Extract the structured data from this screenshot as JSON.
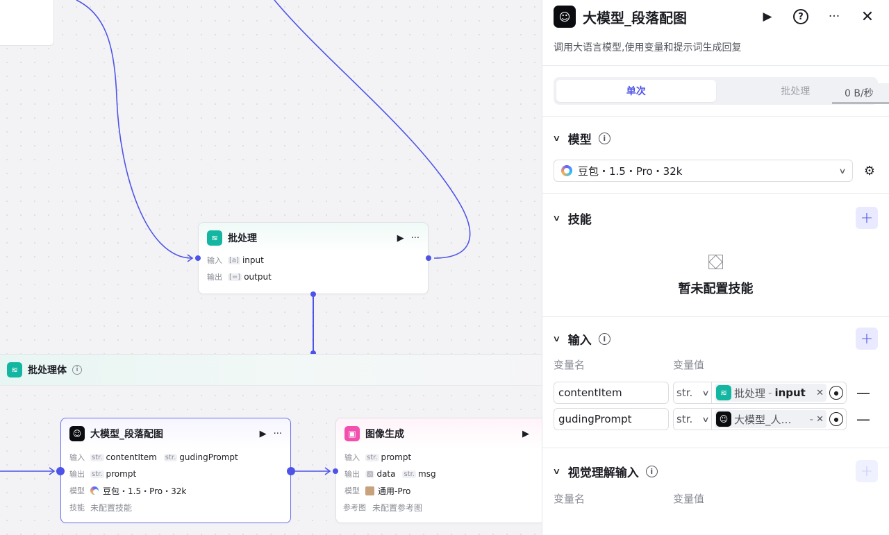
{
  "canvas": {
    "batch_node": {
      "title": "批处理",
      "input_key": "输入",
      "output_key": "输出",
      "input_tag_pre": "[a]",
      "input_tag": "input",
      "output_tag_pre": "[=]",
      "output_tag": "output"
    },
    "batch_band": {
      "title": "批处理体"
    },
    "llm_node": {
      "title": "大模型_段落配图",
      "input_key": "输入",
      "inputs": [
        {
          "pre": "str.",
          "name": "contentItem"
        },
        {
          "pre": "str.",
          "name": "gudingPrompt"
        }
      ],
      "output_key": "输出",
      "outputs": [
        {
          "pre": "str.",
          "name": "prompt"
        }
      ],
      "model_key": "模型",
      "model": "豆包・1.5・Pro・32k",
      "skill_key": "技能",
      "skill": "未配置技能"
    },
    "image_node": {
      "title": "图像生成",
      "input_key": "输入",
      "inputs": [
        {
          "pre": "str.",
          "name": "prompt"
        }
      ],
      "output_key": "输出",
      "outputs": [
        {
          "pre": "▨",
          "name": "data"
        },
        {
          "pre": "str.",
          "name": "msg"
        }
      ],
      "model_key": "模型",
      "model": "通用-Pro",
      "ref_key": "参考图",
      "ref": "未配置参考图"
    }
  },
  "panel": {
    "title": "大模型_段落配图",
    "description": "调用大语言模型,使用变量和提示词生成回复",
    "mode_tabs": [
      "单次",
      "批处理"
    ],
    "net_speed": "0 B/秒",
    "model_section": {
      "title": "模型",
      "selected": "豆包・1.5・Pro・32k"
    },
    "skill_section": {
      "title": "技能",
      "empty": "暂未配置技能"
    },
    "input_section": {
      "title": "输入",
      "col_name": "变量名",
      "col_value": "变量值",
      "rows": [
        {
          "name": "contentItem",
          "type": "str.",
          "ref_node": "批处理",
          "ref_field": "input"
        },
        {
          "name": "gudingPrompt",
          "type": "str.",
          "ref_node": "大模型_人…",
          "ref_field": "-"
        }
      ]
    },
    "vision_section": {
      "title": "视觉理解输入",
      "col_name": "变量名",
      "col_value": "变量值"
    }
  },
  "colors": {
    "accent": "#4d53e8",
    "batch_teal": "#13b6a0",
    "image_pink": "#f24fae",
    "llm_black": "#0b0c10"
  },
  "icons": [
    "play-icon",
    "more-icon",
    "help-icon",
    "close-icon",
    "info-icon",
    "chevron-down-icon",
    "gear-icon",
    "plus-icon",
    "minus-icon",
    "target-icon",
    "empty-box-icon"
  ]
}
